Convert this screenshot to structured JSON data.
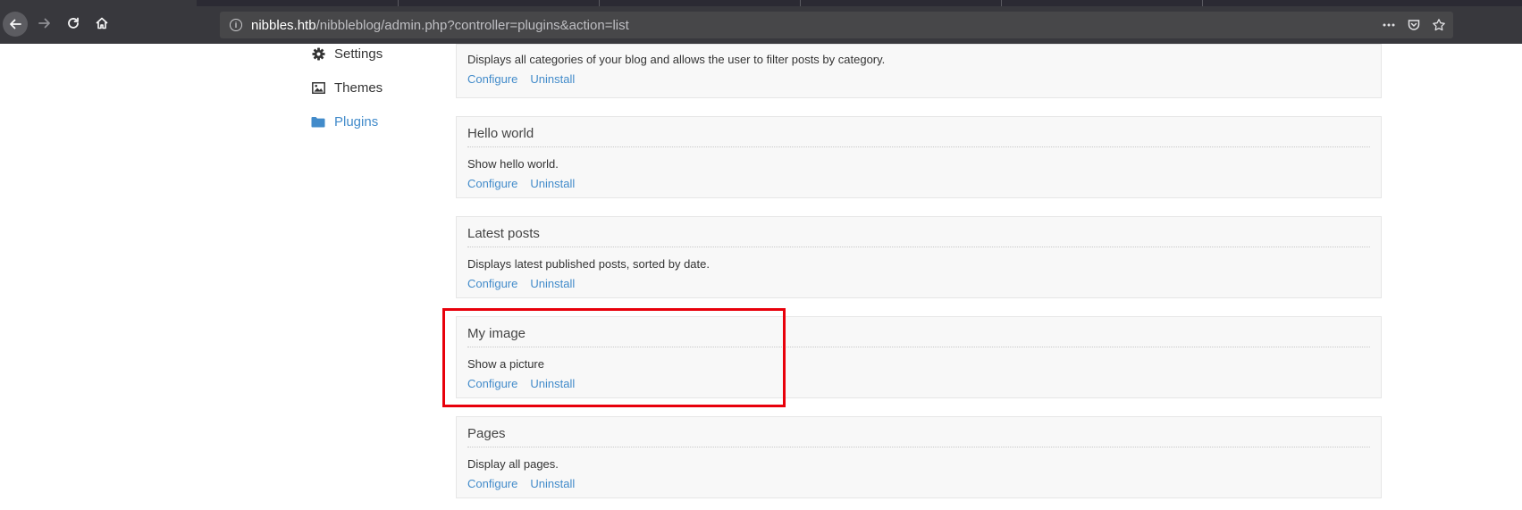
{
  "browser": {
    "url_host": "nibbles.htb",
    "url_path": "/nibbleblog/admin.php?controller=plugins&action=list",
    "icons": {
      "back": "arrow-left-icon",
      "forward": "arrow-right-icon",
      "reload": "reload-icon",
      "home": "home-icon",
      "info": "info-icon",
      "menu": "more-dots-icon",
      "pocket": "pocket-icon",
      "bookmark": "star-icon"
    }
  },
  "sidebar": {
    "items": [
      {
        "label": "Settings",
        "icon": "gear-icon",
        "active": false
      },
      {
        "label": "Themes",
        "icon": "image-icon",
        "active": false
      },
      {
        "label": "Plugins",
        "icon": "folder-icon",
        "active": true
      }
    ]
  },
  "plugins": [
    {
      "title": "",
      "description": "Displays all categories of your blog and allows the user to filter posts by category.",
      "configure": "Configure",
      "uninstall": "Uninstall"
    },
    {
      "title": "Hello world",
      "description": "Show hello world.",
      "configure": "Configure",
      "uninstall": "Uninstall"
    },
    {
      "title": "Latest posts",
      "description": "Displays latest published posts, sorted by date.",
      "configure": "Configure",
      "uninstall": "Uninstall"
    },
    {
      "title": "My image",
      "description": "Show a picture",
      "configure": "Configure",
      "uninstall": "Uninstall",
      "highlighted": true
    },
    {
      "title": "Pages",
      "description": "Display all pages.",
      "configure": "Configure",
      "uninstall": "Uninstall"
    }
  ],
  "colors": {
    "link": "#428bca",
    "highlight": "#e8000b",
    "chrome": "#38383d"
  }
}
